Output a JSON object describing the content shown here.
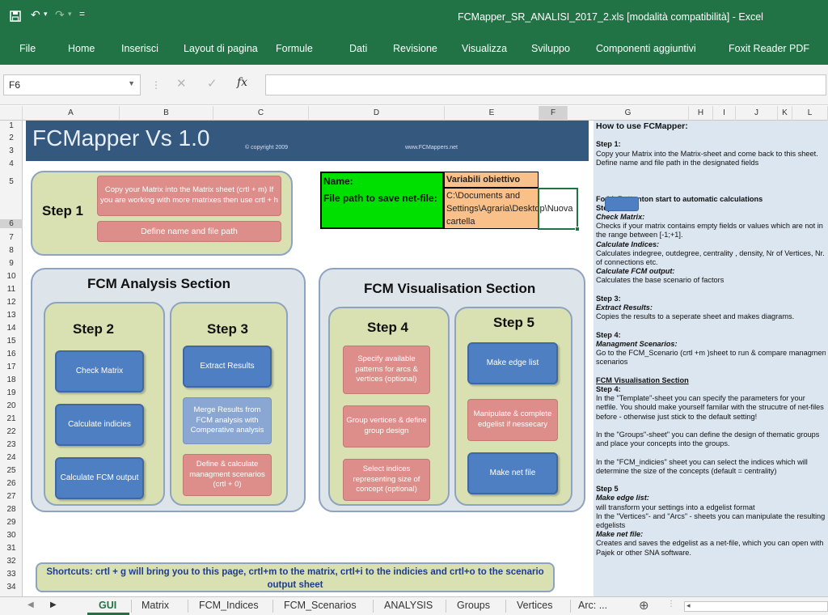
{
  "window": {
    "title": "FCMapper_SR_ANALISI_2017_2.xls  [modalità compatibilità]  -  Excel",
    "qat_save_icon": "save-icon",
    "qat_undo_icon": "undo-icon",
    "qat_redo_icon": "redo-icon",
    "qat_customize_icon": "customize-icon"
  },
  "ribbon": {
    "tabs": [
      "File",
      "Home",
      "Inserisci",
      "Layout di pagina",
      "Formule",
      "Dati",
      "Revisione",
      "Visualizza",
      "Sviluppo",
      "Componenti aggiuntivi",
      "Foxit Reader PDF"
    ]
  },
  "formula_bar": {
    "name_box": "F6",
    "cancel_icon": "✕",
    "enter_icon": "✓",
    "fx_label": "fx",
    "formula": ""
  },
  "columns": [
    "A",
    "B",
    "C",
    "D",
    "E",
    "F",
    "G",
    "H",
    "I",
    "J",
    "K",
    "L"
  ],
  "rows": [
    "1",
    "2",
    "3",
    "4",
    "5",
    "6",
    "7",
    "8",
    "9",
    "10",
    "11",
    "12",
    "13",
    "14",
    "15",
    "16",
    "17",
    "18",
    "19",
    "20",
    "21",
    "22",
    "23",
    "24",
    "25",
    "26",
    "27",
    "28",
    "29",
    "30",
    "31",
    "32",
    "33",
    "34"
  ],
  "banner": {
    "title": "FCMapper   Vs 1.0",
    "copyright": "© copyright 2009",
    "website": "www.FCMappers.net"
  },
  "step1": {
    "label": "Step 1",
    "copy_matrix": "Copy your Matrix into the Matrix sheet (crtl + m) If you are working with more matrixes then use crtl + h",
    "define_name": "Define name and file path"
  },
  "info_cells": {
    "name_label": "Name:",
    "file_path_label": "File path to save net-file:",
    "name_value": "Variabili obiettivo",
    "file_path_value": "C:\\Documents and Settings\\Agraria\\Desktop\\Nuova cartella"
  },
  "analysis": {
    "title": "FCM Analysis Section",
    "step2": {
      "label": "Step 2",
      "check_matrix": "Check Matrix",
      "calculate_indices": "Calculate indicies",
      "calculate_output": "Calculate FCM output"
    },
    "step3": {
      "label": "Step 3",
      "extract_results": "Extract Results",
      "merge_results": "Merge Results from FCM analysis with Comperative analysis",
      "define_scenarios": "Define & calculate managment scenarios (crtl + 0)"
    }
  },
  "visualisation": {
    "title": "FCM Visualisation Section",
    "step4": {
      "label": "Step 4",
      "specify_patterns": "Specify available patterns for  arcs & vertices (optional)",
      "group_vertices": "Group vertices & define group design",
      "select_indices": "Select  indices representing size of concept  (optional)"
    },
    "step5": {
      "label": "Step 5",
      "make_edge_list": "Make edge list",
      "manipulate_edgelist": "Manipulate & complete edgelist if nessecary",
      "make_net_file": "Make net file"
    }
  },
  "shortcuts": "Shortcuts: crtl + g will bring you to this page, crtl+m to the matrix, crtl+i to the indicies and crtl+o to the scenario output sheet",
  "help": {
    "title": "How to use FCMapper:",
    "lines": [
      {
        "t": "",
        "s": "n"
      },
      {
        "t": "Step 1:",
        "s": "b"
      },
      {
        "t": "Copy your Matrix into the Matrix-sheet and come back to this sheet.",
        "s": "n"
      },
      {
        "t": "Define name and file path in the  designated fields",
        "s": "n"
      },
      {
        "t": "",
        "s": "n"
      },
      {
        "t": "",
        "s": "n"
      },
      {
        "t": "",
        "s": "n"
      },
      {
        "t": "Fo          hisButtonton start to automatic calculations",
        "s": "b"
      },
      {
        "t": "Step 2",
        "s": "b"
      },
      {
        "t": "Check Matrix:",
        "s": "bi"
      },
      {
        "t": "Checks if your matrix contains empty fields or values which are not in",
        "s": "n"
      },
      {
        "t": "the range between [-1;+1].",
        "s": "n"
      },
      {
        "t": "Calculate Indices:",
        "s": "bi"
      },
      {
        "t": "Calculates indegree, outdegree, centrality , density, Nr of Vertices, Nr.",
        "s": "n"
      },
      {
        "t": "of connections etc.",
        "s": "n"
      },
      {
        "t": "Calculate FCM output:",
        "s": "bi"
      },
      {
        "t": "Calculates the  base scenario of factors",
        "s": "n"
      },
      {
        "t": "",
        "s": "n"
      },
      {
        "t": "Step 3:",
        "s": "b"
      },
      {
        "t": "Extract Results:",
        "s": "bi"
      },
      {
        "t": "Copies the results to a seperate sheet and makes diagrams.",
        "s": "n"
      },
      {
        "t": "",
        "s": "n"
      },
      {
        "t": "Step 4:",
        "s": "b"
      },
      {
        "t": "Managment Scenarios:",
        "s": "bi"
      },
      {
        "t": "Go to the FCM_Scenario  (crtl +m )sheet to run & compare managment",
        "s": "n"
      },
      {
        "t": "scenarios",
        "s": "n"
      },
      {
        "t": "",
        "s": "n"
      },
      {
        "t": "FCM Visualisation Section",
        "s": "u"
      },
      {
        "t": "Step 4:",
        "s": "b"
      },
      {
        "t": "In the \"Template\"-sheet you can specify the parameters for your",
        "s": "n"
      },
      {
        "t": "netfile. You should make yourself familar with the strucutre of net-files",
        "s": "n"
      },
      {
        "t": "before - otherwise just stick to the default setting!",
        "s": "n"
      },
      {
        "t": "",
        "s": "n"
      },
      {
        "t": "In the \"Groups\"-sheet\" you can define the design of thematic groups",
        "s": "n"
      },
      {
        "t": "and place your concepts into the groups.",
        "s": "n"
      },
      {
        "t": "",
        "s": "n"
      },
      {
        "t": "In the \"FCM_indicies\" sheet you can select the indices which will",
        "s": "n"
      },
      {
        "t": "determine the size of the concepts (default = centrality)",
        "s": "n"
      },
      {
        "t": "",
        "s": "n"
      },
      {
        "t": "Step 5",
        "s": "b"
      },
      {
        "t": "Make edge list:",
        "s": "bi"
      },
      {
        "t": "will transform your settings into a edgelist format",
        "s": "n"
      },
      {
        "t": "In the \"Vertices\"- and \"Arcs\" - sheets you can manipulate the resulting",
        "s": "n"
      },
      {
        "t": "edgelists",
        "s": "n"
      },
      {
        "t": "Make net file:",
        "s": "bi"
      },
      {
        "t": "Creates and saves the edgelist as a net-file, which you can open with",
        "s": "n"
      },
      {
        "t": "Pajek or other SNA software.",
        "s": "n"
      }
    ]
  },
  "sheet_tabs": [
    "GUI",
    "Matrix",
    "FCM_Indices",
    "FCM_Scenarios",
    "ANALYSIS",
    "Groups",
    "Vertices",
    "Arc: ..."
  ],
  "active_tab": "GUI",
  "add_sheet_icon": "⊕"
}
